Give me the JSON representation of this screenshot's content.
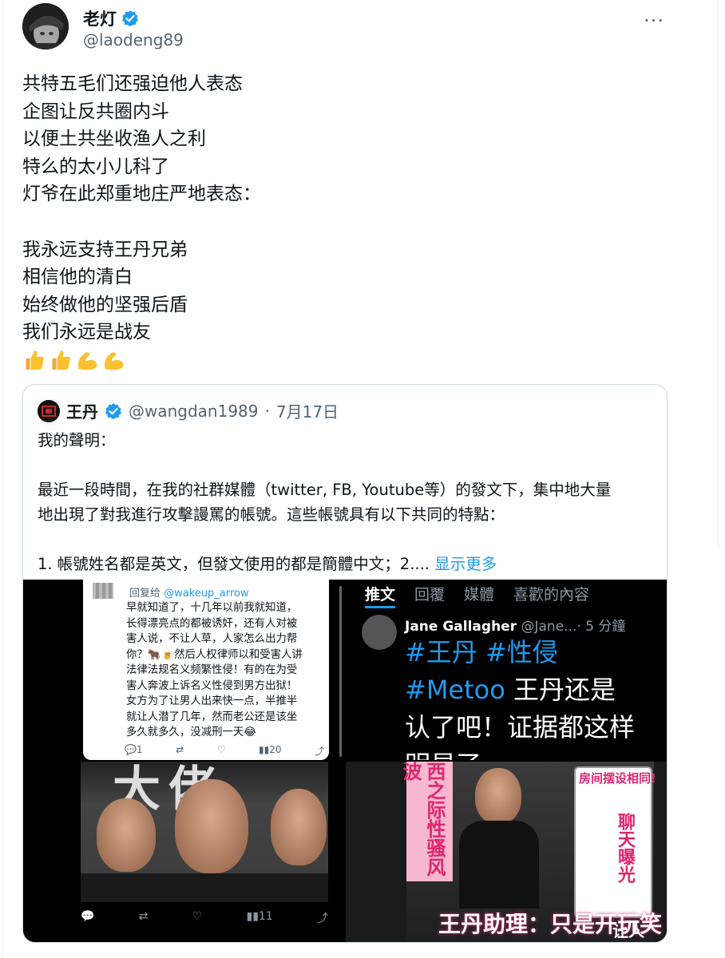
{
  "tweet": {
    "author_name": "老灯",
    "author_handle": "@laodeng89",
    "more_label": "···",
    "lines": [
      "共特五毛们还强迫他人表态",
      "企图让反共圈内斗",
      "以便土共坐收渔人之利",
      "特么的太小儿科了",
      "灯爷在此郑重地庄严地表态：",
      "",
      "我永远支持王丹兄弟",
      "相信他的清白",
      "始终做他的坚强后盾",
      "我们永远是战友"
    ],
    "emojis": [
      "thumbs-up-icon",
      "thumbs-up-icon",
      "flexed-biceps-icon",
      "flexed-biceps-icon"
    ]
  },
  "quote": {
    "author_name": "王丹",
    "author_handle": "@wangdan1989",
    "separator": "·",
    "date": "7月17日",
    "line1": "我的聲明：",
    "line2": "最近一段時間，在我的社群媒體（twitter, FB, Youtube等）的發文下，集中地大量",
    "line3": "地出現了對我進行攻擊謾罵的帳號。這些帳號具有以下共同的特點：",
    "line4": "1. 帳號姓名都是英文，但發文使用的都是簡體中文；2....",
    "show_more": "显示更多"
  },
  "media": {
    "reply_card": {
      "reply_prefix": "回复给",
      "reply_handle": "@wakeup_arrow",
      "body": [
        "早就知道了，十几年以前我就知道，",
        "长得漂亮点的都被诱奸，还有人对被",
        "害人说，不让人草，人家怎么出力帮",
        "你？🐂🍺然后人权律师以和受害人讲",
        "法律法规名义频繁性侵！有的在为受",
        "害人奔波上诉名义性侵到男方出狱！",
        "女方为了让男人出来快一点，半推半",
        "就让人潜了几年，然而老公还是该坐",
        "多久就多久，没减刑一天😂"
      ],
      "replies": "1",
      "views": "20"
    },
    "dark_tweet": {
      "tabs": [
        "推文",
        "回覆",
        "媒體",
        "喜歡的內容"
      ],
      "name": "Jane Gallagher",
      "handle": "@Jane...",
      "time": "· 5 分鐘",
      "tags_line": "#王丹 #性侵",
      "line2_tag": "#Metoo",
      "line2_text": " 王丹还是",
      "line3": "认了吧！证据都这样",
      "line4": "明显了"
    },
    "photo": {
      "bg_text": "大佬",
      "views": "11"
    },
    "poster": {
      "side_text": "西之际性骚风波",
      "chat_title": "房间摆设相同!",
      "chat_big": "聊天曝光",
      "banner": "王丹助理：只是开玩笑",
      "corner": "让人"
    }
  }
}
